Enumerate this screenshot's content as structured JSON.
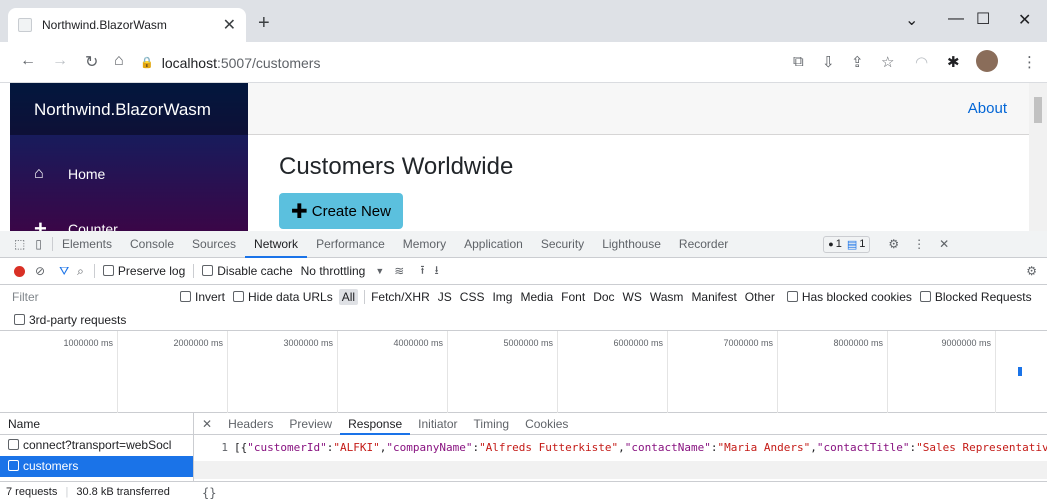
{
  "browser": {
    "tab_title": "Northwind.BlazorWasm",
    "url_host": "localhost",
    "url_rest": ":5007/customers"
  },
  "app": {
    "brand": "Northwind.BlazorWasm",
    "nav": [
      {
        "label": "Home",
        "icon": "home-icon"
      },
      {
        "label": "Counter",
        "icon": "plus-icon"
      }
    ],
    "about_link": "About",
    "heading": "Customers Worldwide",
    "create_button": "Create New"
  },
  "devtools": {
    "tabs": [
      "Elements",
      "Console",
      "Sources",
      "Network",
      "Performance",
      "Memory",
      "Application",
      "Security",
      "Lighthouse",
      "Recorder"
    ],
    "active_tab": "Network",
    "error_badge": "1",
    "message_badge": "1",
    "preserve_log": "Preserve log",
    "disable_cache": "Disable cache",
    "throttling": "No throttling",
    "filter_placeholder": "Filter",
    "invert": "Invert",
    "hide_data_urls": "Hide data URLs",
    "type_filters": [
      "All",
      "Fetch/XHR",
      "JS",
      "CSS",
      "Img",
      "Media",
      "Font",
      "Doc",
      "WS",
      "Wasm",
      "Manifest",
      "Other"
    ],
    "has_blocked_cookies": "Has blocked cookies",
    "blocked_requests": "Blocked Requests",
    "third_party": "3rd-party requests",
    "timeline_ticks": [
      "1000000 ms",
      "2000000 ms",
      "3000000 ms",
      "4000000 ms",
      "5000000 ms",
      "6000000 ms",
      "7000000 ms",
      "8000000 ms",
      "9000000 ms"
    ],
    "requests_header": "Name",
    "requests": [
      "connect?transport=webSocl",
      "customers"
    ],
    "selected_request": "customers",
    "detail_tabs": [
      "Headers",
      "Preview",
      "Response",
      "Initiator",
      "Timing",
      "Cookies"
    ],
    "active_detail_tab": "Response",
    "status_requests": "7 requests",
    "status_transferred": "30.8 kB transferred",
    "response": {
      "line_number": "1",
      "pairs": [
        {
          "key": "\"customerId\"",
          "value": "\"ALFKI\""
        },
        {
          "key": "\"companyName\"",
          "value": "\"Alfreds Futterkiste\""
        },
        {
          "key": "\"contactName\"",
          "value": "\"Maria Anders\""
        },
        {
          "key": "\"contactTitle\"",
          "value": "\"Sales Representative\""
        }
      ],
      "prefix": "[{"
    },
    "pretty_print": "{}"
  }
}
